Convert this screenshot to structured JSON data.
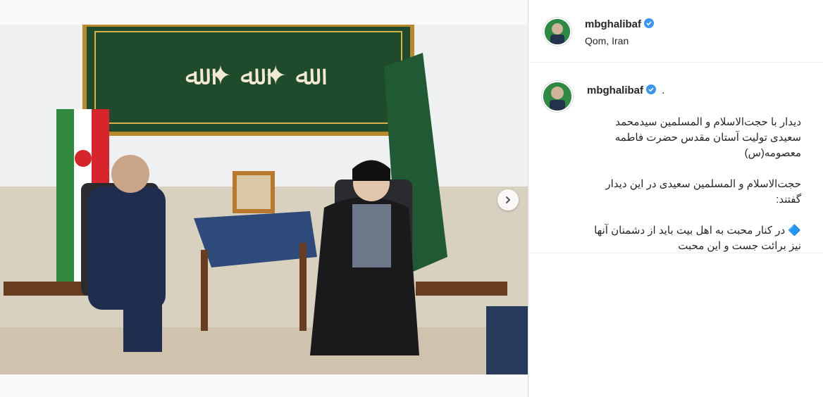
{
  "post": {
    "username": "mbghalibaf",
    "location": "Qom, Iran",
    "photo_alt": "",
    "carousel": {
      "slides": 2,
      "active": 1
    }
  },
  "caption": {
    "username": "mbghalibaf",
    "suffix": ".",
    "text": "دیدار با حجت‌الاسلام و المسلمین سیدمحمد سعیدی تولیت آستان مقدس حضرت فاطمه معصومه(س)\n\nحجت‌الاسلام و المسلمین سعیدی در این دیدار گفتند:\n\n🔷 در کنار محبت به اهل بیت باید از دشمنان آنها نیز برائت جست و این محبت"
  },
  "colors": {
    "verified": "#3897f0",
    "text": "#262626",
    "border": "#dbdbdb"
  },
  "icons": {
    "verified": "verified-badge-icon",
    "next": "chevron-right-icon"
  }
}
